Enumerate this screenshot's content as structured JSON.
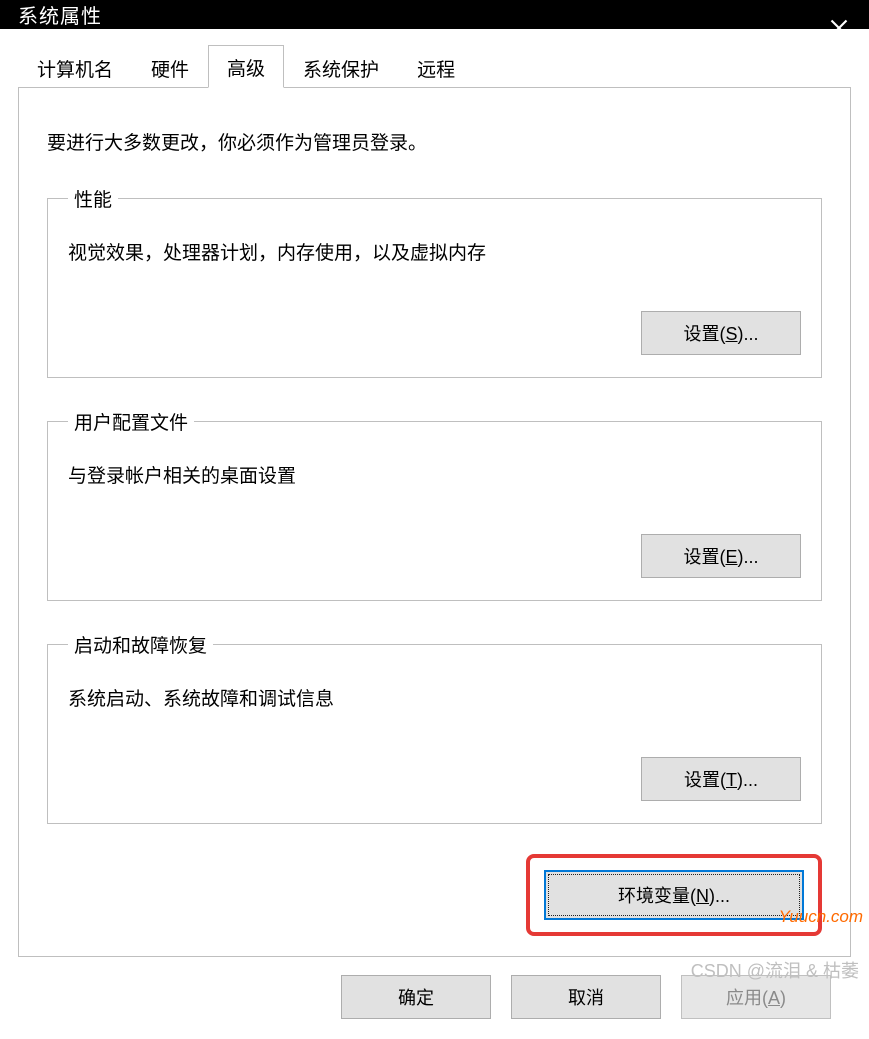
{
  "window": {
    "title": "系统属性"
  },
  "tabs": [
    {
      "label": "计算机名",
      "active": false
    },
    {
      "label": "硬件",
      "active": false
    },
    {
      "label": "高级",
      "active": true
    },
    {
      "label": "系统保护",
      "active": false
    },
    {
      "label": "远程",
      "active": false
    }
  ],
  "intro": "要进行大多数更改，你必须作为管理员登录。",
  "groups": {
    "performance": {
      "legend": "性能",
      "desc": "视觉效果，处理器计划，内存使用，以及虚拟内存",
      "button": "设置(S)...",
      "hotkey": "S"
    },
    "profiles": {
      "legend": "用户配置文件",
      "desc": "与登录帐户相关的桌面设置",
      "button": "设置(E)...",
      "hotkey": "E"
    },
    "startup": {
      "legend": "启动和故障恢复",
      "desc": "系统启动、系统故障和调试信息",
      "button": "设置(T)...",
      "hotkey": "T"
    }
  },
  "env_button": {
    "label": "环境变量(N)...",
    "hotkey": "N"
  },
  "dialog_buttons": {
    "ok": "确定",
    "cancel": "取消",
    "apply": "应用(A)",
    "apply_hotkey": "A"
  },
  "watermark": {
    "site": "Yuucn.com",
    "author": "CSDN @流泪 & 枯萎"
  }
}
